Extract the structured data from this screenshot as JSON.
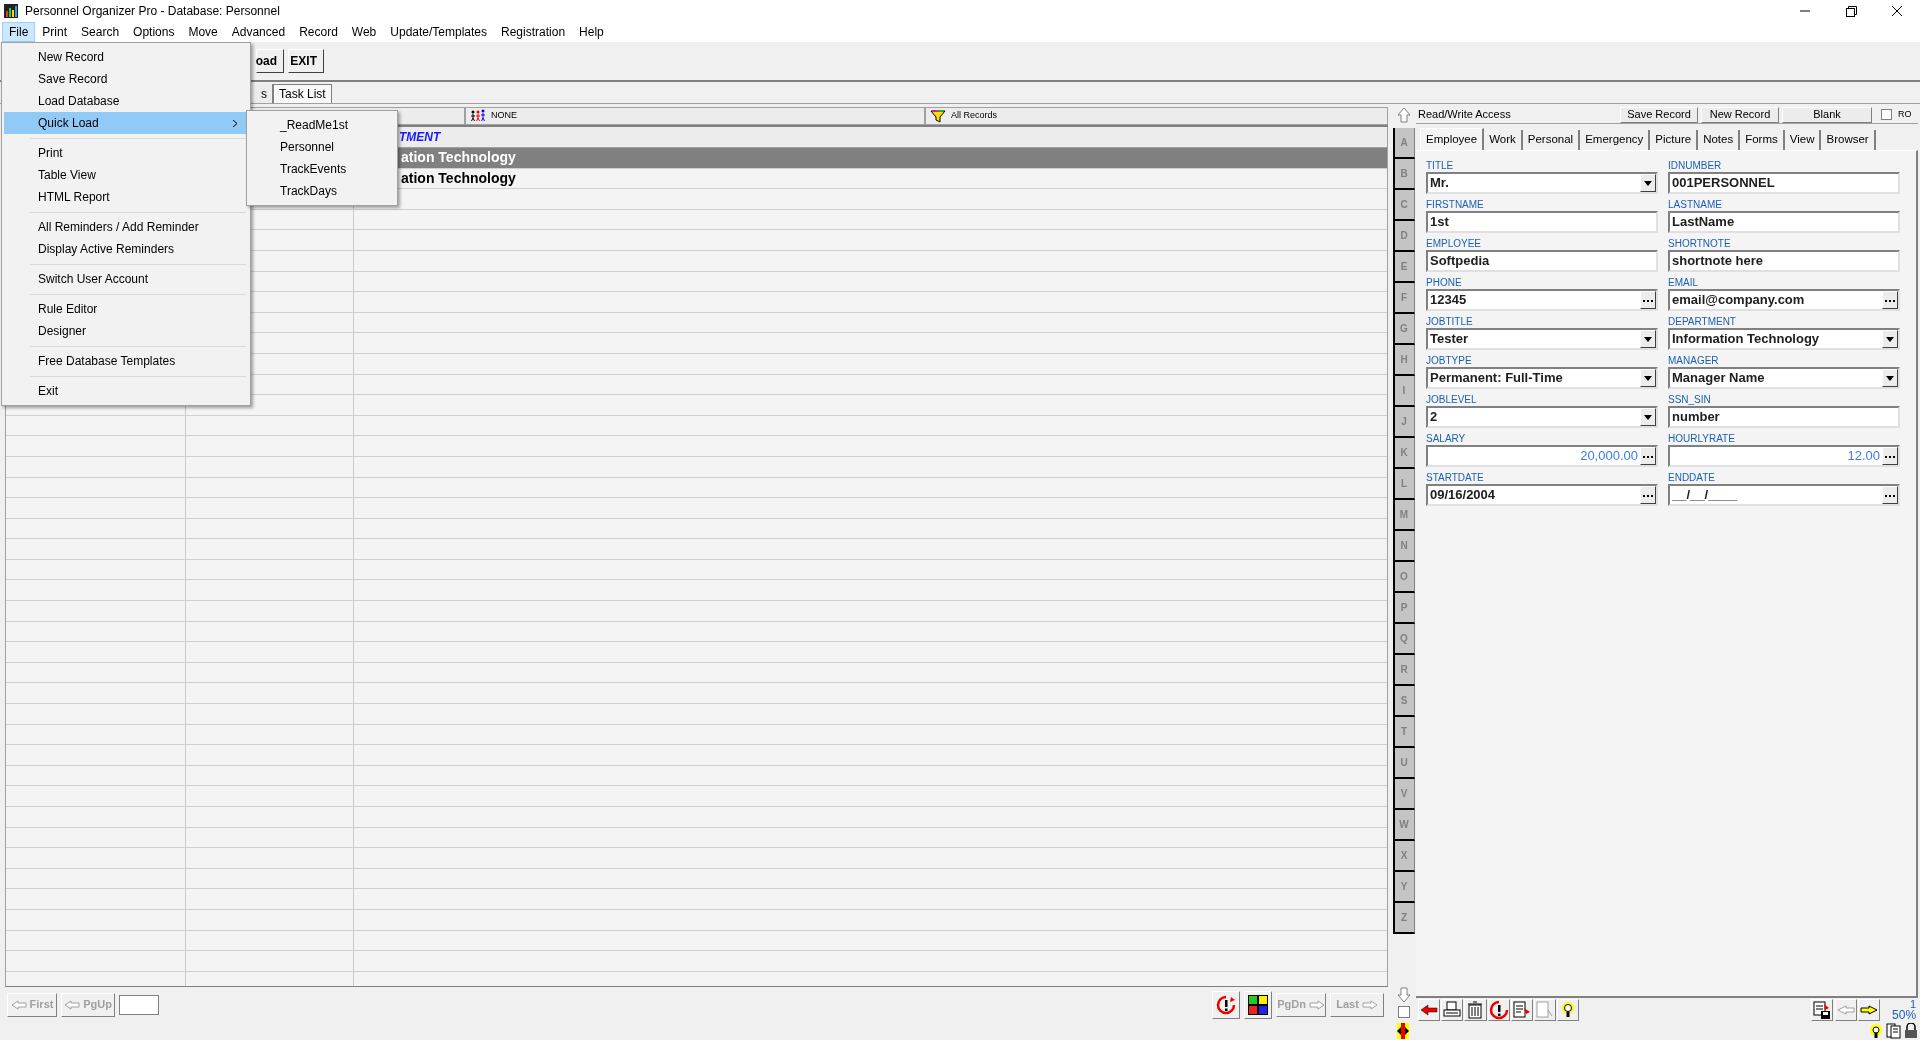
{
  "window": {
    "title": "Personnel Organizer Pro - Database: Personnel"
  },
  "menu_bar": [
    {
      "label": "File",
      "selected": true
    },
    {
      "label": "Print",
      "selected": false
    },
    {
      "label": "Search",
      "selected": false
    },
    {
      "label": "Options",
      "selected": false
    },
    {
      "label": "Move",
      "selected": false
    },
    {
      "label": "Advanced",
      "selected": false
    },
    {
      "label": "Record",
      "selected": false
    },
    {
      "label": "Web",
      "selected": false
    },
    {
      "label": "Update/Templates",
      "selected": false
    },
    {
      "label": "Registration",
      "selected": false
    },
    {
      "label": "Help",
      "selected": false
    }
  ],
  "file_menu": [
    {
      "kind": "item",
      "label": "New Record",
      "selected": false
    },
    {
      "kind": "item",
      "label": "Save Record",
      "selected": false
    },
    {
      "kind": "item",
      "label": "Load Database",
      "selected": false
    },
    {
      "kind": "submenu",
      "label": "Quick Load",
      "selected": true
    },
    {
      "kind": "separator"
    },
    {
      "kind": "item",
      "label": "Print",
      "selected": false
    },
    {
      "kind": "item",
      "label": "Table View",
      "selected": false
    },
    {
      "kind": "item",
      "label": "HTML Report",
      "selected": false
    },
    {
      "kind": "separator"
    },
    {
      "kind": "item",
      "label": "All Reminders / Add Reminder",
      "selected": false
    },
    {
      "kind": "item",
      "label": "Display Active Reminders",
      "selected": false
    },
    {
      "kind": "separator"
    },
    {
      "kind": "item",
      "label": "Switch User Account",
      "selected": false
    },
    {
      "kind": "separator"
    },
    {
      "kind": "item",
      "label": "Rule Editor",
      "selected": false
    },
    {
      "kind": "item",
      "label": "Designer",
      "selected": false
    },
    {
      "kind": "separator"
    },
    {
      "kind": "item",
      "label": "Free Database Templates",
      "selected": false
    },
    {
      "kind": "separator"
    },
    {
      "kind": "item",
      "label": "Exit",
      "selected": false
    }
  ],
  "quick_load_submenu": [
    "_ReadMe1st",
    "Personnel",
    "TrackEvents",
    "TrackDays"
  ],
  "toolbar": {
    "buttons": [
      "oad",
      "EXIT"
    ]
  },
  "view_tabs": [
    {
      "label": "s",
      "selected": false
    },
    {
      "label": "Task List",
      "selected": true
    }
  ],
  "grid": {
    "filters": [
      "NONE",
      "All Records"
    ],
    "group_heading": "TMENT",
    "rows": [
      {
        "text": "ation Technology",
        "selected": true
      },
      {
        "text": "ation Technology",
        "selected": false
      }
    ]
  },
  "grid_nav": {
    "left_buttons": [
      {
        "label": "First",
        "disabled": true
      },
      {
        "label": "PgUp",
        "disabled": true
      }
    ],
    "right_buttons": [
      {
        "label": "PgDn",
        "disabled": true
      },
      {
        "label": "Last",
        "disabled": true
      }
    ]
  },
  "alphabet_checkbox": {
    "checked": false
  },
  "alphabet": [
    "A",
    "B",
    "C",
    "D",
    "E",
    "F",
    "G",
    "H",
    "I",
    "J",
    "K",
    "L",
    "M",
    "N",
    "O",
    "P",
    "Q",
    "R",
    "S",
    "T",
    "U",
    "V",
    "W",
    "X",
    "Y",
    "Z"
  ],
  "record_panel": {
    "access": "Read/Write Access",
    "buttons": [
      "Save Record",
      "New Record",
      "Blank"
    ],
    "ro": {
      "label": "RO",
      "checked": false
    },
    "tabs": [
      {
        "label": "Employee",
        "selected": true
      },
      {
        "label": "Work",
        "selected": false
      },
      {
        "label": "Personal",
        "selected": false
      },
      {
        "label": "Emergency",
        "selected": false
      },
      {
        "label": "Picture",
        "selected": false
      },
      {
        "label": "Notes",
        "selected": false
      },
      {
        "label": "Forms",
        "selected": false
      },
      {
        "label": "View",
        "selected": false
      },
      {
        "label": "Browser",
        "selected": false
      }
    ],
    "fields": [
      {
        "label": "TITLE",
        "value": "Mr.",
        "kind": "dropdown"
      },
      {
        "label": "IDNUMBER",
        "value": "001PERSONNEL",
        "kind": "text"
      },
      {
        "label": "FIRSTNAME",
        "value": "1st",
        "kind": "text"
      },
      {
        "label": "LASTNAME",
        "value": "LastName",
        "kind": "text"
      },
      {
        "label": "EMPLOYEE",
        "value": "Softpedia",
        "kind": "text"
      },
      {
        "label": "SHORTNOTE",
        "value": "shortnote here",
        "kind": "text"
      },
      {
        "label": "PHONE",
        "value": "12345",
        "kind": "more"
      },
      {
        "label": "EMAIL",
        "value": "email@company.com",
        "kind": "more"
      },
      {
        "label": "JOBTITLE",
        "value": "Tester",
        "kind": "dropdown"
      },
      {
        "label": "DEPARTMENT",
        "value": "Information Technology",
        "kind": "dropdown"
      },
      {
        "label": "JOBTYPE",
        "value": "Permanent: Full-Time",
        "kind": "dropdown"
      },
      {
        "label": "MANAGER",
        "value": "Manager Name",
        "kind": "dropdown"
      },
      {
        "label": "JOBLEVEL",
        "value": "2",
        "kind": "dropdown"
      },
      {
        "label": "SSN_SIN",
        "value": "number",
        "kind": "text"
      },
      {
        "label": "SALARY",
        "value": "20,000.00",
        "kind": "number"
      },
      {
        "label": "HOURLYRATE",
        "value": "12.00",
        "kind": "number"
      },
      {
        "label": "STARTDATE",
        "value": "09/16/2004",
        "kind": "more"
      },
      {
        "label": "ENDDATE",
        "value": "__/__/____",
        "kind": "more"
      }
    ],
    "record_number": "1",
    "zoom": "50%"
  }
}
